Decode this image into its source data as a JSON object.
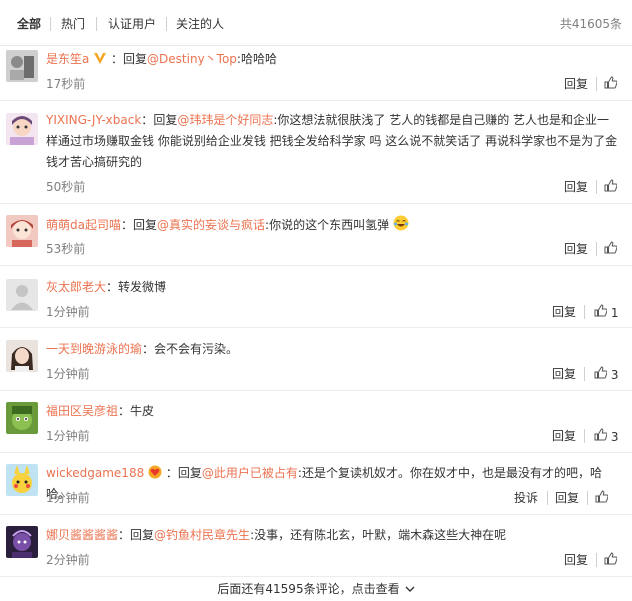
{
  "tabs": [
    {
      "label": "全部",
      "active": true
    },
    {
      "label": "热门"
    },
    {
      "label": "认证用户"
    },
    {
      "label": "关注的人"
    }
  ],
  "total": "共41605条",
  "comments": [
    {
      "user": "是东笙a",
      "sep": "：",
      "reply": "回复",
      "target": "@Destiny丶Top",
      "text": ":哈哈哈",
      "time": "17秒前",
      "action": "回复",
      "likes": ""
    },
    {
      "user": "YIXING-JY-xback",
      "sep": "：",
      "reply": "回复",
      "target": "@玮玮是个好同志",
      "text": ":你这想法就很肤浅了 艺人的钱都是自己赚的 艺人也是和企业一样通过市场赚取金钱 你能说别给企业发钱 把钱全发给科学家 吗 这么说不就笑话了 再说科学家也不是为了金钱才苦心搞研究的",
      "time": "50秒前",
      "action": "回复",
      "likes": ""
    },
    {
      "user": "萌萌da起司喵",
      "sep": "：",
      "reply": "回复",
      "target": "@真实的妄谈与疯话",
      "text": ":你说的这个东西叫氢弹",
      "time": "53秒前",
      "action": "回复",
      "likes": ""
    },
    {
      "user": "灰太郎老大",
      "sep": "：",
      "reply": "",
      "target": "",
      "text": "转发微博",
      "time": "1分钟前",
      "action": "回复",
      "likes": "1"
    },
    {
      "user": "一天到晚游泳的瑜",
      "sep": "：",
      "reply": "",
      "target": "",
      "text": "会不会有污染。",
      "time": "1分钟前",
      "action": "回复",
      "likes": "3"
    },
    {
      "user": "福田区吴彦祖",
      "sep": "：",
      "reply": "",
      "target": "",
      "text": "牛皮",
      "time": "1分钟前",
      "action": "回复",
      "likes": "3"
    },
    {
      "user": "wickedgame188",
      "sep": "：",
      "reply": "回复",
      "target": "@此用户已被占有",
      "text": ":还是个复读机奴才。你在奴才中，也是最没有才的吧，哈哈。",
      "time": "1分钟前",
      "action": "投诉",
      "action2": "回复",
      "likes": ""
    },
    {
      "user": "娜贝酱酱酱酱",
      "sep": "：",
      "reply": "回复",
      "target": "@钓鱼村民章先生",
      "text": ":没事，还有陈北玄，叶默，端木森这些大神在呢",
      "time": "2分钟前",
      "action": "回复",
      "likes": ""
    }
  ],
  "more_label": "后面还有41595条评论，点击查看",
  "colors": {
    "link": "#eb7350",
    "muted": "#808080",
    "text": "#333333",
    "vip": "#f5a623"
  },
  "icons": [
    "thumbs-up-icon",
    "vip-badge-icon",
    "heart-badge-icon",
    "laugh-emoji-icon",
    "chevron-down-icon"
  ]
}
